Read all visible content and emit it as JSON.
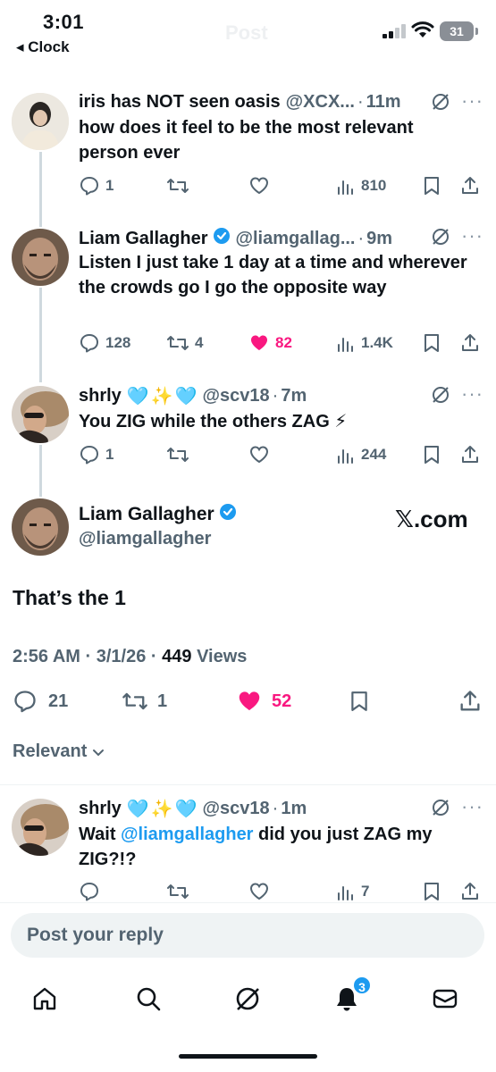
{
  "status_bar": {
    "time": "3:01",
    "back_label": "◂ Clock",
    "battery": "31",
    "screen_title": "Post"
  },
  "tweets": [
    {
      "name": "iris has NOT seen oasis",
      "handle": "@XCX...",
      "time": "11m",
      "text": "how does it feel to be the most relevant person ever",
      "replies": "1",
      "reposts": "",
      "likes": "",
      "views": "810"
    },
    {
      "name": "Liam Gallagher",
      "handle": "@liamgallag...",
      "time": "9m",
      "text": "Listen I just take 1 day at a time and wherever the crowds go I go the opposite way",
      "replies": "128",
      "reposts": "4",
      "likes": "82",
      "views": "1.4K"
    },
    {
      "name": "shrly",
      "handle": "@scv18",
      "time": "7m",
      "text": "You ZIG while the others ZAG ⚡",
      "replies": "1",
      "reposts": "",
      "likes": "",
      "views": "244"
    }
  ],
  "main_tweet": {
    "name": "Liam Gallagher",
    "handle": "@liamgallagher",
    "watermark": "𝕏.com",
    "text": "That’s the 1",
    "time": "2:56 AM",
    "date": "3/1/26",
    "views_count": "449",
    "views_label": "Views",
    "replies": "21",
    "reposts": "1",
    "likes": "52"
  },
  "sort_label": "Relevant",
  "replies": [
    {
      "name": "shrly",
      "handle": "@scv18",
      "time": "1m",
      "text_prefix": "Wait ",
      "mention": "@liamgallagher",
      "text_suffix": " did you just ZAG my ZIG?!?",
      "replies": "",
      "reposts": "",
      "likes": "",
      "views": "7"
    }
  ],
  "reply_placeholder": "Post your reply",
  "notifications_badge": "3",
  "colors": {
    "accent": "#1d9bf0",
    "like": "#f91880",
    "muted": "#536471",
    "text": "#0f1419"
  }
}
